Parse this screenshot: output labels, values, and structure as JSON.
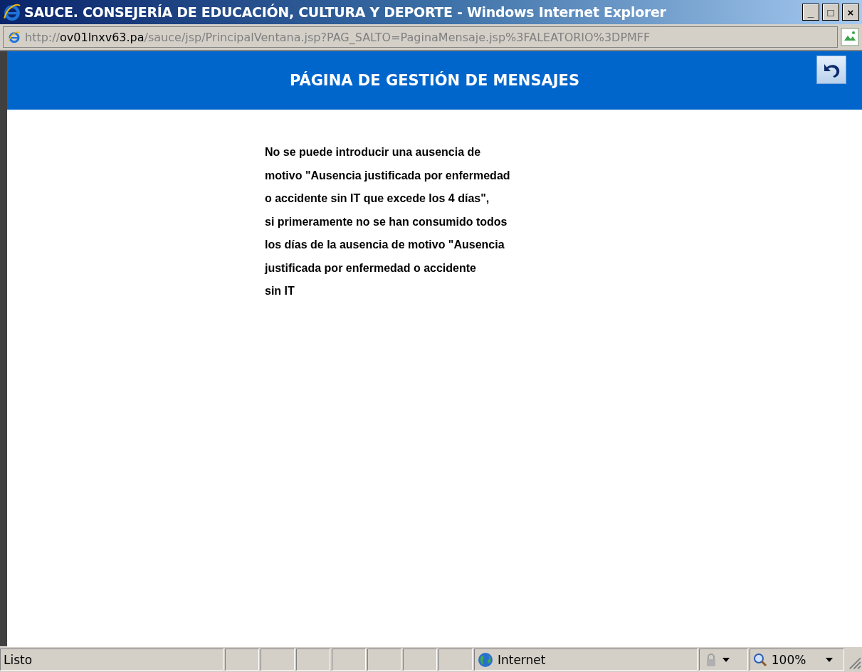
{
  "window": {
    "title": "SAUCE. CONSEJERÍA DE EDUCACIÓN, CULTURA Y DEPORTE - Windows Internet Explorer",
    "controls": [
      "_",
      "□",
      "×"
    ]
  },
  "address": {
    "scheme": "http://",
    "host": "ov01lnxv63.pa",
    "path": "/sauce/jsp/PrincipalVentana.jsp?PAG_SALTO=PaginaMensaje.jsp%3FALEATORIO%3DPMFF"
  },
  "header": {
    "title": "PÁGINA DE GESTIÓN DE MENSAJES"
  },
  "message": "No se puede introducir una ausencia de\nmotivo \"Ausencia justificada por enfermedad\no accidente sin IT que excede los 4 días\",\nsi primeramente no se han consumido todos\nlos días de la ausencia de motivo \"Ausencia\njustificada por enfermedad o accidente\nsin IT",
  "status_bar": {
    "status": "Listo",
    "zone": "Internet",
    "zoom": "100%"
  }
}
